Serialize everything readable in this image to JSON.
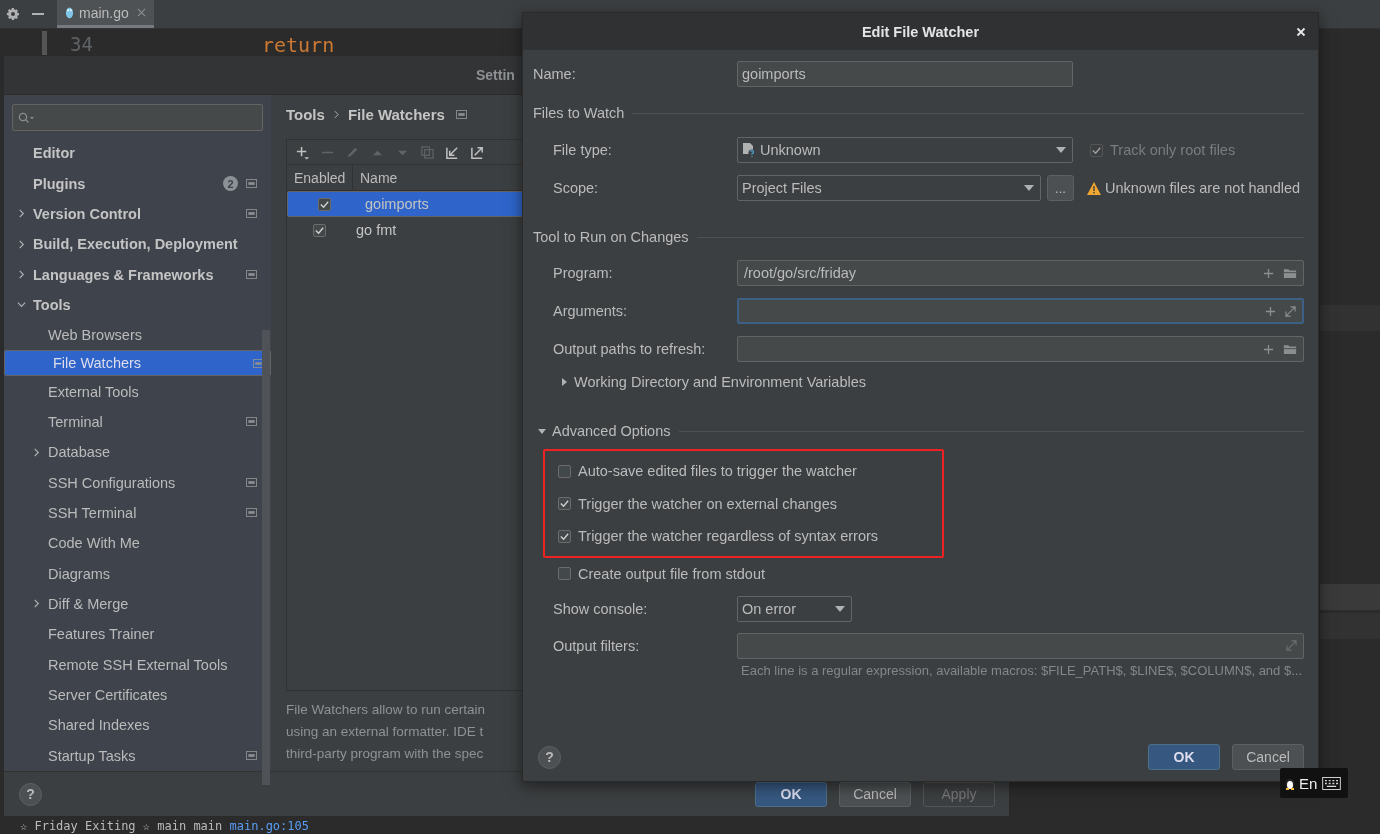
{
  "editor": {
    "tab": {
      "label": "main.go",
      "selected": true
    },
    "line_number": "34",
    "code": "return",
    "console_line": {
      "text": "☆ Friday Exiting ☆ main main",
      "link": "main.go:105"
    }
  },
  "settings": {
    "title": "Settin",
    "help": "?",
    "sidebar": {
      "items": [
        {
          "label": "Editor",
          "selected": false
        },
        {
          "label": "Plugins",
          "selected": false,
          "badge": "2",
          "project_scope": true
        },
        {
          "label": "Version Control",
          "selected": false,
          "expanded": false,
          "project_scope": true
        },
        {
          "label": "Build, Execution, Deployment",
          "selected": false,
          "expanded": false
        },
        {
          "label": "Languages & Frameworks",
          "selected": false,
          "expanded": false,
          "project_scope": true
        },
        {
          "label": "Tools",
          "selected": false,
          "expanded": true,
          "children": [
            {
              "label": "Web Browsers",
              "selected": false
            },
            {
              "label": "File Watchers",
              "selected": true,
              "project_scope": true
            },
            {
              "label": "External Tools",
              "selected": false
            },
            {
              "label": "Terminal",
              "selected": false,
              "project_scope": true
            },
            {
              "label": "Database",
              "selected": false,
              "expanded": false
            },
            {
              "label": "SSH Configurations",
              "selected": false,
              "project_scope": true
            },
            {
              "label": "SSH Terminal",
              "selected": false,
              "project_scope": true
            },
            {
              "label": "Code With Me",
              "selected": false
            },
            {
              "label": "Diagrams",
              "selected": false
            },
            {
              "label": "Diff & Merge",
              "selected": false,
              "expanded": false
            },
            {
              "label": "Features Trainer",
              "selected": false
            },
            {
              "label": "Remote SSH External Tools",
              "selected": false
            },
            {
              "label": "Server Certificates",
              "selected": false
            },
            {
              "label": "Shared Indexes",
              "selected": false
            },
            {
              "label": "Startup Tasks",
              "selected": false,
              "project_scope": true
            }
          ]
        }
      ]
    },
    "breadcrumb": [
      "Tools",
      "File Watchers"
    ],
    "toolbar": [
      {
        "kind": "add",
        "disabled": false
      },
      {
        "kind": "remove",
        "disabled": true
      },
      {
        "kind": "edit",
        "disabled": true
      },
      {
        "kind": "up",
        "disabled": true
      },
      {
        "kind": "down",
        "disabled": true
      },
      {
        "kind": "copy",
        "disabled": true
      },
      {
        "kind": "import",
        "disabled": false
      },
      {
        "kind": "export",
        "disabled": false
      }
    ],
    "table": {
      "columns": [
        "Enabled",
        "Name"
      ],
      "rows": [
        {
          "enabled": true,
          "name": "goimports",
          "selected": true
        },
        {
          "enabled": true,
          "name": "go fmt",
          "selected": false
        }
      ]
    },
    "description": [
      "File Watchers allow to run certain",
      "using an external formatter. IDE t",
      "third-party program with the spec"
    ],
    "buttons": [
      {
        "label": "OK",
        "kind": "primary",
        "disabled": false
      },
      {
        "label": "Cancel",
        "kind": "normal",
        "disabled": false
      },
      {
        "label": "Apply",
        "kind": "normal",
        "disabled": true
      }
    ]
  },
  "edit_dialog": {
    "title": "Edit File Watcher",
    "help": "?",
    "name": {
      "label": "Name:",
      "value": "goimports"
    },
    "files_to_watch": {
      "title": "Files to Watch",
      "file_type": {
        "label": "File type:",
        "value": "Unknown"
      },
      "track_only_root": {
        "label": "Track only root files",
        "checked": true,
        "disabled": true
      },
      "scope": {
        "label": "Scope:",
        "value": "Project Files",
        "more": "..."
      },
      "warning": "Unknown files are not handled"
    },
    "tool": {
      "title": "Tool to Run on Changes",
      "program": {
        "label": "Program:",
        "value": "/root/go/src/friday",
        "focused": false
      },
      "arguments": {
        "label": "Arguments:",
        "focused": true
      },
      "output_paths": {
        "label": "Output paths to refresh:",
        "focused": false
      },
      "working_directory": {
        "label": "Working Directory and Environment Variables",
        "expanded": false
      }
    },
    "advanced": {
      "title": "Advanced Options",
      "expanded": true,
      "options": [
        {
          "label": "Auto-save edited files to trigger the watcher",
          "checked": false,
          "highlighted": true
        },
        {
          "label": "Trigger the watcher on external changes",
          "checked": true,
          "highlighted": true
        },
        {
          "label": "Trigger the watcher regardless of syntax errors",
          "checked": true,
          "highlighted": true
        },
        {
          "label": "Create output file from stdout",
          "checked": false,
          "highlighted": false
        }
      ],
      "show_console": {
        "label": "Show console:",
        "value": "On error"
      },
      "output_filters": {
        "label": "Output filters:"
      },
      "hint": "Each line is a regular expression, available macros: $FILE_PATH$, $LINE$, $COLUMN$, and $..."
    },
    "buttons": [
      {
        "label": "OK",
        "kind": "primary"
      },
      {
        "label": "Cancel",
        "kind": "normal"
      }
    ]
  },
  "ime_indicator": {
    "text": "En"
  }
}
